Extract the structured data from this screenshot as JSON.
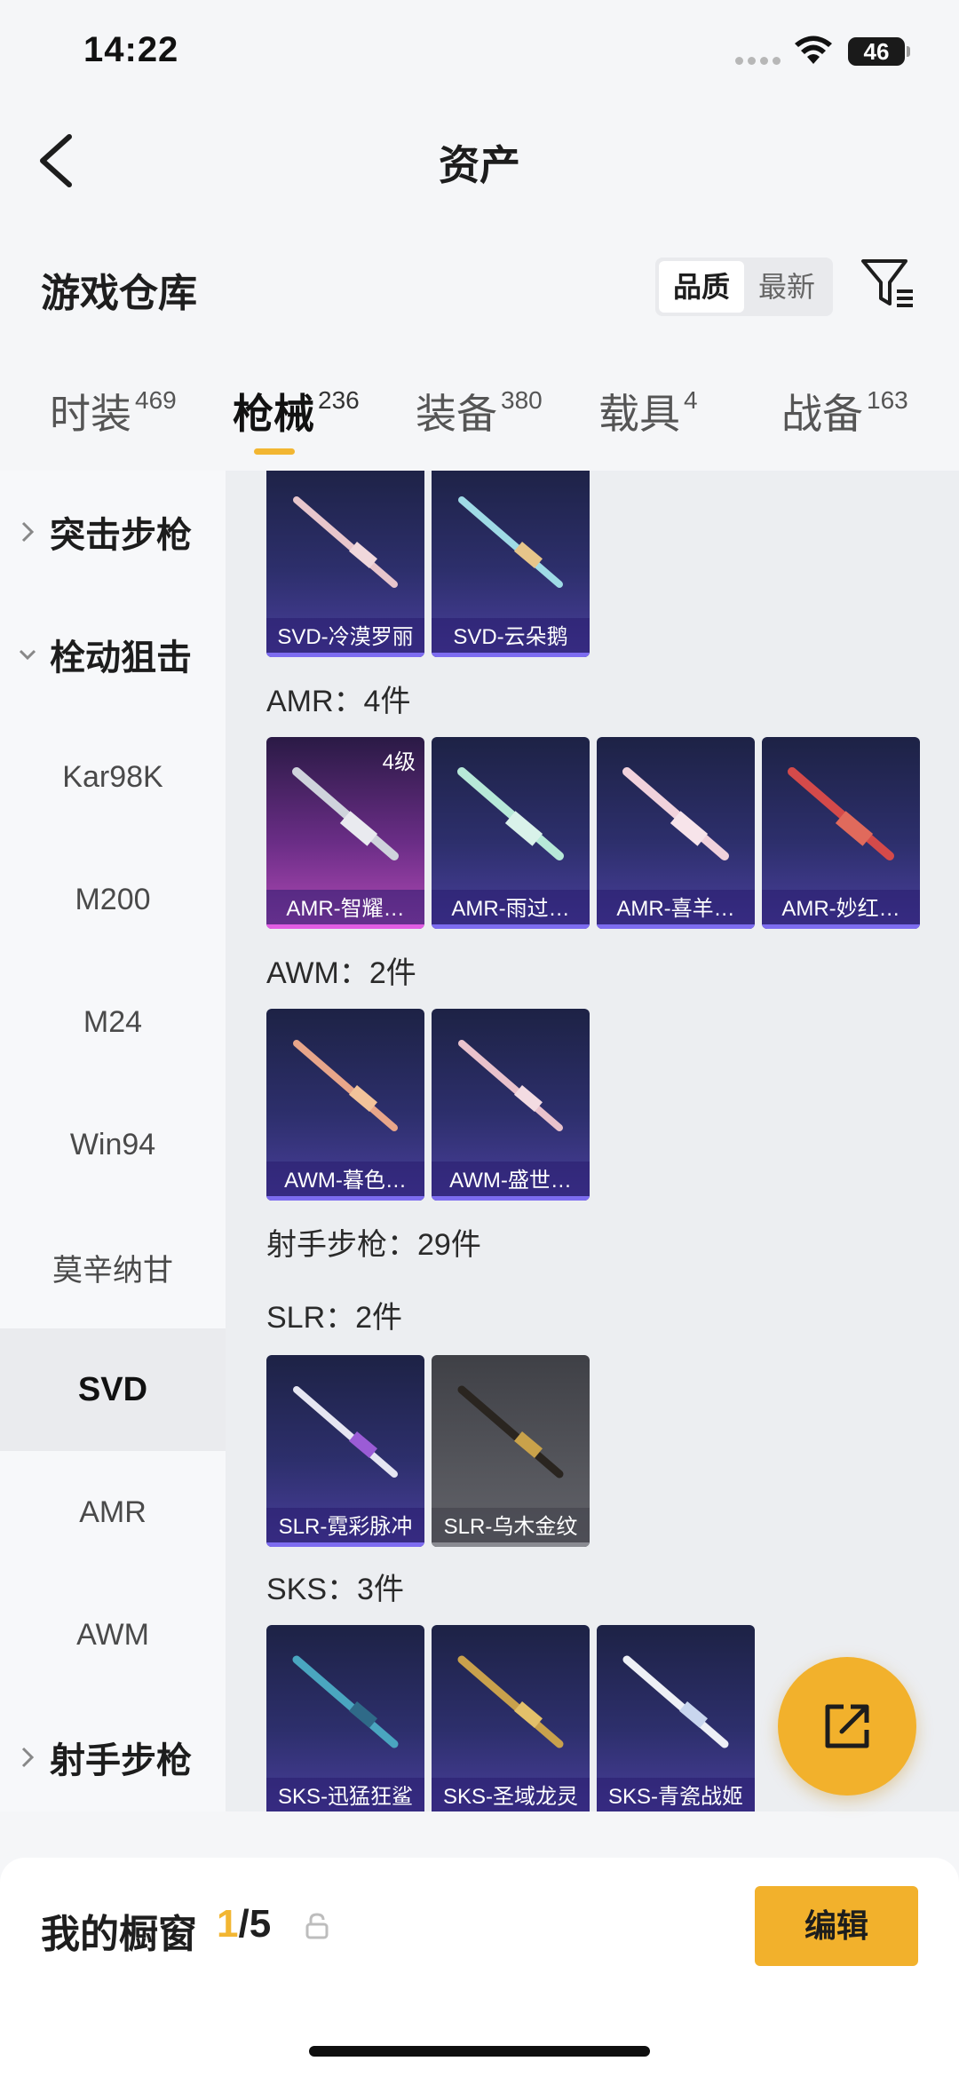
{
  "status_bar": {
    "time": "14:22",
    "battery": "46"
  },
  "nav": {
    "title": "资产"
  },
  "section": {
    "title": "游戏仓库",
    "sort_options": [
      "品质",
      "最新"
    ],
    "active_sort": "品质"
  },
  "tabs": [
    {
      "label": "时装",
      "count": "469"
    },
    {
      "label": "枪械",
      "count": "236"
    },
    {
      "label": "装备",
      "count": "380"
    },
    {
      "label": "载具",
      "count": "4"
    },
    {
      "label": "战备",
      "count": "163"
    }
  ],
  "active_tab": "枪械",
  "sidebar": [
    {
      "label": "突击步枪",
      "type": "group",
      "expanded": false
    },
    {
      "label": "栓动狙击",
      "type": "group",
      "expanded": true
    },
    {
      "label": "Kar98K",
      "type": "item"
    },
    {
      "label": "M200",
      "type": "item"
    },
    {
      "label": "M24",
      "type": "item"
    },
    {
      "label": "Win94",
      "type": "item"
    },
    {
      "label": "莫辛纳甘",
      "type": "item"
    },
    {
      "label": "SVD",
      "type": "item",
      "selected": true
    },
    {
      "label": "AMR",
      "type": "item"
    },
    {
      "label": "AWM",
      "type": "item"
    },
    {
      "label": "射手步枪",
      "type": "group",
      "expanded": false
    }
  ],
  "content": {
    "svd_items": [
      "SVD-冷漠罗丽",
      "SVD-云朵鹅"
    ],
    "amr_label": "AMR：4件",
    "amr_items": [
      "AMR-智耀…",
      "AMR-雨过…",
      "AMR-喜羊…",
      "AMR-妙红…"
    ],
    "amr_level": "4级",
    "awm_label": "AWM：2件",
    "awm_items": [
      "AWM-暮色…",
      "AWM-盛世…"
    ],
    "marksman_label": "射手步枪：29件",
    "slr_label": "SLR：2件",
    "slr_items": [
      "SLR-霓彩脉冲",
      "SLR-乌木金纹"
    ],
    "sks_label": "SKS：3件",
    "sks_items": [
      "SKS-迅猛狂鲨",
      "SKS-圣域龙灵",
      "SKS-青瓷战姬"
    ]
  },
  "showcase": {
    "title": "我的橱窗",
    "current": "1",
    "total": "/5",
    "edit_label": "编辑"
  },
  "colors": {
    "accent": "#f2b632",
    "card_bg": "#2d2f6c",
    "card_pink": "#b24ab6"
  },
  "icons": {
    "back": "chevron-left-icon",
    "filter": "filter-icon",
    "share": "share-icon",
    "lock": "lock-icon"
  }
}
